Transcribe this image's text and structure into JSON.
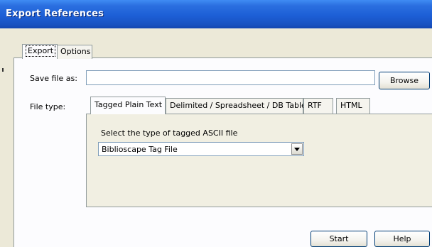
{
  "window": {
    "title": "Export References"
  },
  "top_tabs": [
    {
      "label": "Export",
      "active": true
    },
    {
      "label": "Options",
      "active": false
    }
  ],
  "save_file": {
    "label": "Save file as:",
    "value": "",
    "placeholder": ""
  },
  "browse_button": "Browse",
  "file_type": {
    "label": "File type:",
    "tabs": [
      {
        "label": "Tagged Plain Text",
        "active": true
      },
      {
        "label": "Delimited / Spreadsheet / DB Table",
        "active": false
      },
      {
        "label": "RTF",
        "active": false
      },
      {
        "label": "HTML",
        "active": false
      }
    ]
  },
  "tagged": {
    "prompt": "Select the type of tagged ASCII file",
    "selected": "Biblioscape Tag File"
  },
  "buttons": {
    "start": "Start",
    "help": "Help"
  },
  "colors": {
    "titlebar": "#1d5fd6",
    "face": "#ece9d8",
    "panel": "#fcfcfe",
    "tab_border": "#919b9c"
  }
}
